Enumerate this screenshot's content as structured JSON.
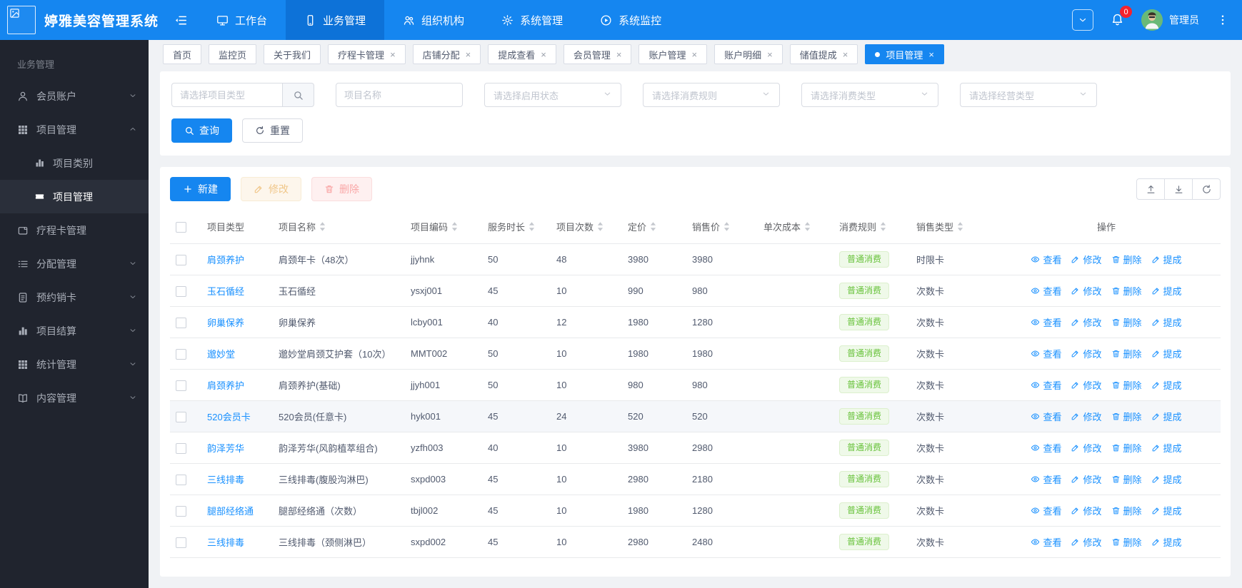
{
  "app": {
    "title": "婷雅美容管理系统",
    "user": "管理员",
    "notification_count": "0"
  },
  "colors": {
    "topbar": "#1586f0",
    "accent": "#1890ff",
    "sidebar": "#20242e",
    "badge_green": "#67c23a",
    "notification_red": "#f5222d"
  },
  "topnav": {
    "items": [
      {
        "label": "工作台",
        "icon": "desktop",
        "active": false
      },
      {
        "label": "业务管理",
        "icon": "mobile",
        "active": true
      },
      {
        "label": "组织机构",
        "icon": "team",
        "active": false
      },
      {
        "label": "系统管理",
        "icon": "gear",
        "active": false
      },
      {
        "label": "系统监控",
        "icon": "play-circle",
        "active": false
      }
    ]
  },
  "tabs": [
    {
      "label": "首页",
      "closable": false,
      "active": false
    },
    {
      "label": "监控页",
      "closable": false,
      "active": false
    },
    {
      "label": "关于我们",
      "closable": false,
      "active": false
    },
    {
      "label": "疗程卡管理",
      "closable": true,
      "active": false
    },
    {
      "label": "店铺分配",
      "closable": true,
      "active": false
    },
    {
      "label": "提成查看",
      "closable": true,
      "active": false
    },
    {
      "label": "会员管理",
      "closable": true,
      "active": false
    },
    {
      "label": "账户管理",
      "closable": true,
      "active": false
    },
    {
      "label": "账户明细",
      "closable": true,
      "active": false
    },
    {
      "label": "储值提成",
      "closable": true,
      "active": false
    },
    {
      "label": "项目管理",
      "closable": true,
      "active": true
    }
  ],
  "sidebar": {
    "section": "业务管理",
    "items": [
      {
        "label": "会员账户",
        "icon": "user",
        "chevron": "down"
      },
      {
        "label": "项目管理",
        "icon": "grid",
        "chevron": "up",
        "expanded": true,
        "children": [
          {
            "label": "项目类别",
            "icon": "chart",
            "active": false
          },
          {
            "label": "项目管理",
            "icon": "ticket",
            "active": true
          }
        ]
      },
      {
        "label": "疗程卡管理",
        "icon": "card"
      },
      {
        "label": "分配管理",
        "icon": "list",
        "chevron": "down"
      },
      {
        "label": "预约销卡",
        "icon": "document",
        "chevron": "down"
      },
      {
        "label": "项目结算",
        "icon": "chart",
        "chevron": "down"
      },
      {
        "label": "统计管理",
        "icon": "grid",
        "chevron": "down"
      },
      {
        "label": "内容管理",
        "icon": "book",
        "chevron": "down"
      }
    ]
  },
  "filters": {
    "project_type_placeholder": "请选择项目类型",
    "project_name_placeholder": "项目名称",
    "selects": [
      "请选择启用状态",
      "请选择消费规则",
      "请选择消费类型",
      "请选择经营类型"
    ],
    "search_label": "查询",
    "reset_label": "重置"
  },
  "toolbar": {
    "new_label": "新建",
    "edit_label": "修改",
    "delete_label": "删除"
  },
  "table": {
    "columns": [
      {
        "label": "项目类型",
        "sortable": false
      },
      {
        "label": "项目名称",
        "sortable": true
      },
      {
        "label": "项目编码",
        "sortable": true
      },
      {
        "label": "服务时长",
        "sortable": true
      },
      {
        "label": "项目次数",
        "sortable": true
      },
      {
        "label": "定价",
        "sortable": true
      },
      {
        "label": "销售价",
        "sortable": true
      },
      {
        "label": "单次成本",
        "sortable": true
      },
      {
        "label": "消费规则",
        "sortable": true
      },
      {
        "label": "销售类型",
        "sortable": true
      },
      {
        "label": "操作",
        "sortable": false,
        "align": "center"
      }
    ],
    "actions": [
      "查看",
      "修改",
      "删除",
      "提成"
    ],
    "rows": [
      {
        "type": "肩颈养护",
        "name": "肩颈年卡（48次）",
        "code": "jjyhnk",
        "duration": "50",
        "times": "48",
        "price": "3980",
        "sale_price": "3980",
        "unit_cost": "",
        "rule": "普通消费",
        "sale_type": "时限卡",
        "highlight": false
      },
      {
        "type": "玉石循经",
        "name": "玉石循经",
        "code": "ysxj001",
        "duration": "45",
        "times": "10",
        "price": "990",
        "sale_price": "980",
        "unit_cost": "",
        "rule": "普通消费",
        "sale_type": "次数卡",
        "highlight": false
      },
      {
        "type": "卵巢保养",
        "name": "卵巢保养",
        "code": "lcby001",
        "duration": "40",
        "times": "12",
        "price": "1980",
        "sale_price": "1280",
        "unit_cost": "",
        "rule": "普通消费",
        "sale_type": "次数卡",
        "highlight": false
      },
      {
        "type": "邈妙堂",
        "name": "邈妙堂肩颈艾护套（10次）",
        "code": "MMT002",
        "duration": "50",
        "times": "10",
        "price": "1980",
        "sale_price": "1980",
        "unit_cost": "",
        "rule": "普通消费",
        "sale_type": "次数卡",
        "highlight": false
      },
      {
        "type": "肩颈养护",
        "name": "肩颈养护(基础)",
        "code": "jjyh001",
        "duration": "50",
        "times": "10",
        "price": "980",
        "sale_price": "980",
        "unit_cost": "",
        "rule": "普通消费",
        "sale_type": "次数卡",
        "highlight": false
      },
      {
        "type": "520会员卡",
        "name": "520会员(任意卡)",
        "code": "hyk001",
        "duration": "45",
        "times": "24",
        "price": "520",
        "sale_price": "520",
        "unit_cost": "",
        "rule": "普通消费",
        "sale_type": "次数卡",
        "highlight": true
      },
      {
        "type": "韵泽芳华",
        "name": "韵泽芳华(风韵植萃组合)",
        "code": "yzfh003",
        "duration": "40",
        "times": "10",
        "price": "3980",
        "sale_price": "2980",
        "unit_cost": "",
        "rule": "普通消费",
        "sale_type": "次数卡",
        "highlight": false
      },
      {
        "type": "三线排毒",
        "name": "三线排毒(腹股沟淋巴)",
        "code": "sxpd003",
        "duration": "45",
        "times": "10",
        "price": "2980",
        "sale_price": "2180",
        "unit_cost": "",
        "rule": "普通消费",
        "sale_type": "次数卡",
        "highlight": false
      },
      {
        "type": "腿部经络通",
        "name": "腿部经络通（次数）",
        "code": "tbjl002",
        "duration": "45",
        "times": "10",
        "price": "1980",
        "sale_price": "1280",
        "unit_cost": "",
        "rule": "普通消费",
        "sale_type": "次数卡",
        "highlight": false
      },
      {
        "type": "三线排毒",
        "name": "三线排毒（颈侧淋巴）",
        "code": "sxpd002",
        "duration": "45",
        "times": "10",
        "price": "2980",
        "sale_price": "2480",
        "unit_cost": "",
        "rule": "普通消费",
        "sale_type": "次数卡",
        "highlight": false
      }
    ]
  }
}
